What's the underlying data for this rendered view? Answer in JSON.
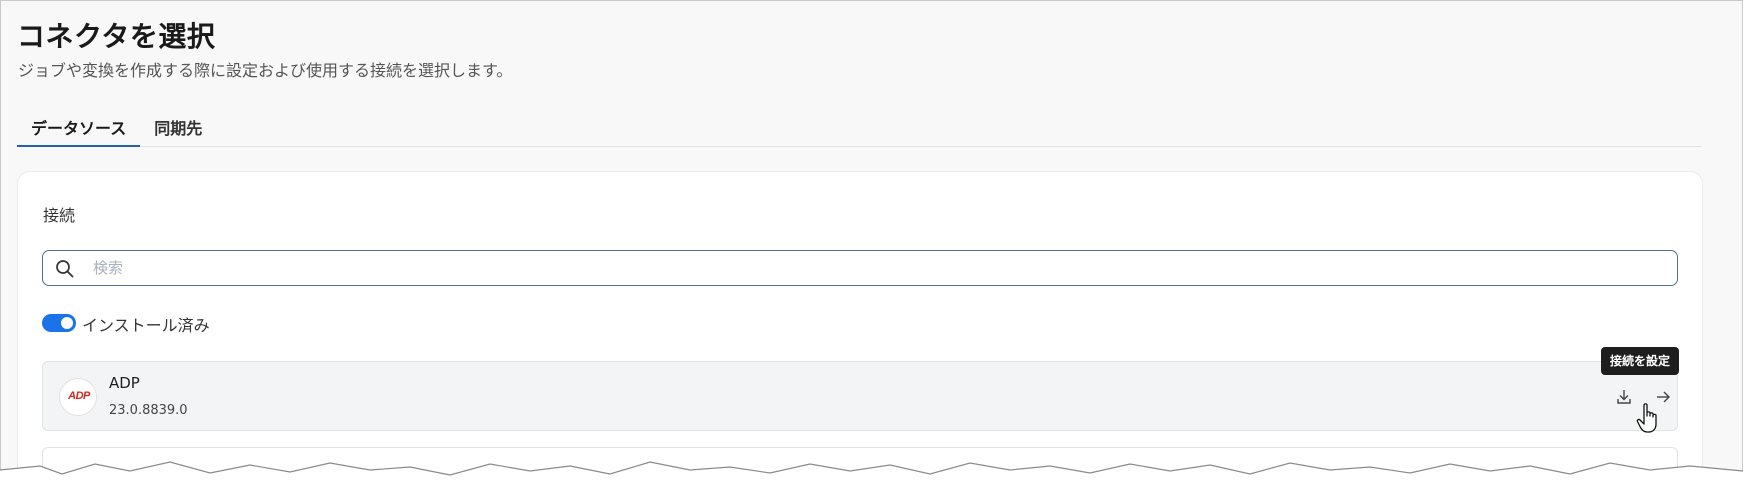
{
  "page": {
    "title": "コネクタを選択",
    "subtitle": "ジョブや変換を作成する際に設定および使用する接続を選択します。"
  },
  "tabs": [
    {
      "label": "データソース",
      "active": true
    },
    {
      "label": "同期先",
      "active": false
    }
  ],
  "panel": {
    "section_label": "接続",
    "search": {
      "placeholder": "検索",
      "value": ""
    },
    "installed_toggle": {
      "label": "インストール済み",
      "on": true
    }
  },
  "connectors": [
    {
      "name": "ADP",
      "version": "23.0.8839.0",
      "logo_text": "ADP",
      "icons": [
        "download-icon",
        "arrow-right-icon"
      ]
    }
  ],
  "tooltip": {
    "text": "接続を設定"
  },
  "colors": {
    "accent": "#1a73e8",
    "tab_underline": "#2563a8",
    "logo_red": "#d0271d",
    "tooltip_bg": "#1e1e1e"
  }
}
